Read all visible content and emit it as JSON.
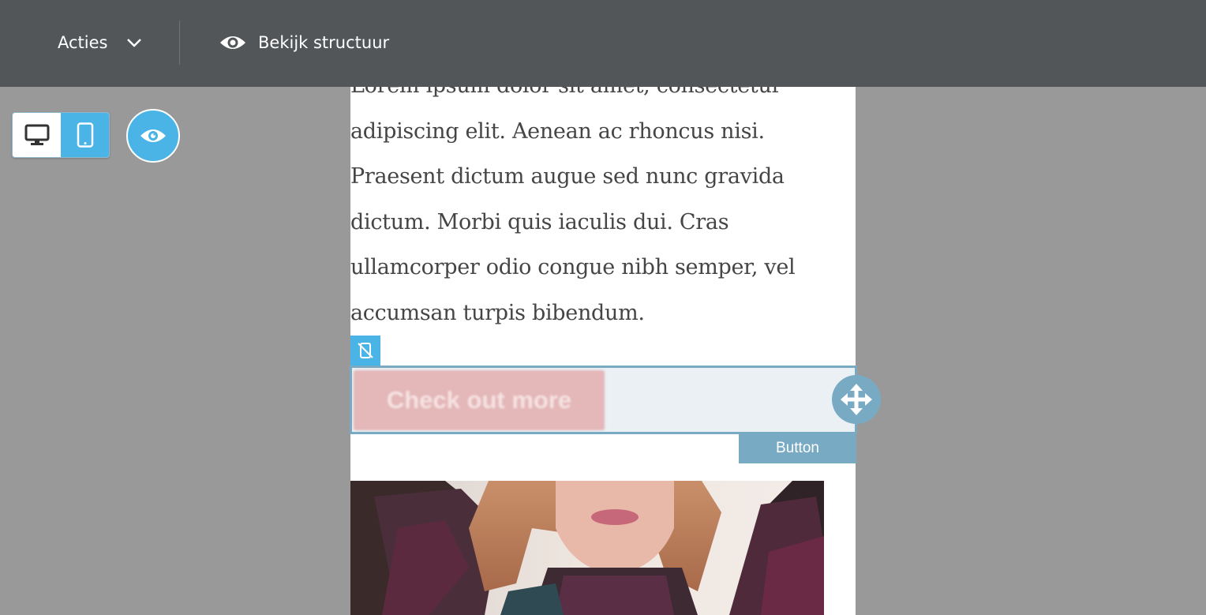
{
  "toolbar": {
    "actions_label": "Acties",
    "structure_label": "Bekijk structuur"
  },
  "device_toggle": {
    "options": [
      "desktop",
      "mobile"
    ],
    "selected": "mobile"
  },
  "content": {
    "paragraph": "Lorem ipsum dolor sit amet, consectetur adipiscing elit. Aenean ac rhoncus nisi. Praesent dictum augue sed nunc gravida dictum. Morbi quis iaculis dui. Cras ullamcorper odio congue nibh semper, vel accumsan turpis bibendum.",
    "cta_label": "Check out more",
    "block_type_label": "Button"
  },
  "icons": {
    "actions_chevron": "chevron-down-icon",
    "structure": "eye-icon",
    "desktop": "desktop-icon",
    "mobile": "mobile-icon",
    "preview": "eye-icon",
    "hide_on_mobile": "mobile-off-icon",
    "move": "move-icon"
  },
  "colors": {
    "topbar": "#525659",
    "accent": "#4bb4e6",
    "selection": "#79aac4",
    "cta_background": "#e4b7b8"
  }
}
